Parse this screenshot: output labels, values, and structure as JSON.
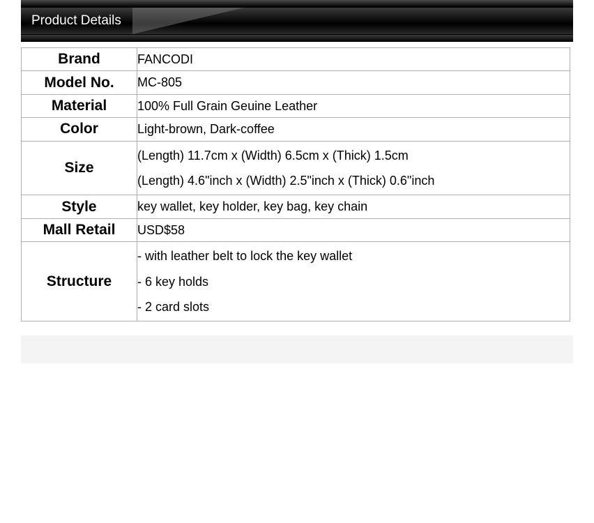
{
  "header": {
    "title": "Product Details"
  },
  "rows": [
    {
      "label": "Brand",
      "value": "FANCODI"
    },
    {
      "label": "Model No.",
      "value": "MC-805"
    },
    {
      "label": "Material",
      "value": "100% Full Grain Geuine Leather"
    },
    {
      "label": "Color",
      "value": "Light-brown, Dark-coffee"
    },
    {
      "label": "Size",
      "lines": [
        "(Length) 11.7cm x (Width) 6.5cm x (Thick) 1.5cm",
        "(Length) 4.6\"inch x (Width) 2.5\"inch x (Thick) 0.6\"inch"
      ]
    },
    {
      "label": "Style",
      "value": "key wallet, key holder, key bag, key chain"
    },
    {
      "label": "Mall Retail",
      "value": "USD$58"
    },
    {
      "label": "Structure",
      "lines": [
        "- with leather belt to lock the key wallet",
        "- 6 key holds",
        "- 2 card slots"
      ]
    }
  ]
}
